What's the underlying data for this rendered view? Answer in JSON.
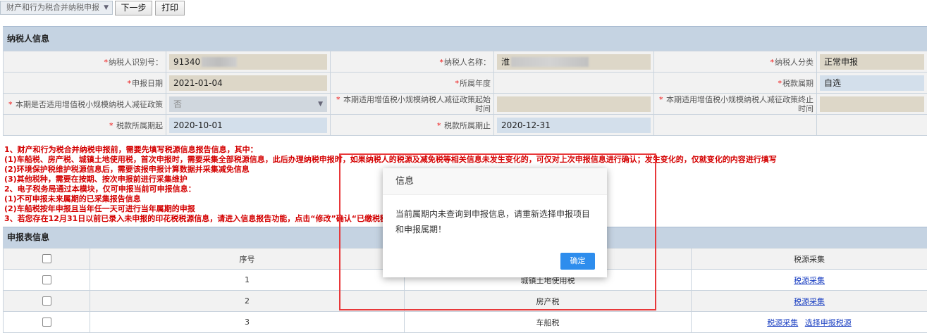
{
  "toolbar": {
    "project_select": "财产和行为税合并纳税申报",
    "next_label": "下一步",
    "print_label": "打印"
  },
  "taxpayer_section": {
    "title": "纳税人信息",
    "id_label": "纳税人识别号：",
    "id_value": "91340",
    "name_label": "纳税人名称：",
    "name_value": "淮",
    "category_label": "纳税人分类",
    "category_value": "正常申报",
    "date_label": "申报日期",
    "date_value": "2021-01-04",
    "year_label": "所属年度",
    "period_label": "税款属期",
    "period_value": "自选",
    "policy_label": "本期是否适用增值税小规模纳税人减征政策",
    "policy_value": "否",
    "policy_start_label": "本期适用增值税小规模纳税人减征政策起始时间",
    "policy_end_label": "本期适用增值税小规模纳税人减征政策终止时间",
    "start_label": "税款所属期起",
    "start_value": "2020-10-01",
    "end_label": "税款所属期止",
    "end_value": "2020-12-31"
  },
  "notices": [
    "1、财产和行为税合并纳税申报前，需要先填写税源信息报告信息，其中：",
    "(1)车船税、房产税、城镇土地使用税，首次申报时，需要采集全部税源信息，此后办理纳税申报时，如果纳税人的税源及减免税等相关信息未发生变化的，可仅对上次申报信息进行确认；发生变化的，仅就变化的内容进行填写",
    "(2)环境保护税维护税源信息后，需要该报申报计算数据并采集减免信息",
    "(3)其他税种，需要在按期、按次申报前进行采集维护",
    "2、电子税务局通过本模块，仅可申报当前可申报信息：",
    "(1)不可申报未来属期的已采集报告信息",
    "(2)车船税按年申报且当年任一天可进行当年属期的申报",
    "3、若您存在12月31日以前已录入未申报的印花税税源信息，请进入信息报告功能，点击“修改”确认“已缴税额”"
  ],
  "declaration_section": {
    "title": "申报表信息",
    "col_seq": "序号",
    "col_source": "税源采集",
    "rows": [
      {
        "seq": "1",
        "tax": "城镇土地使用税",
        "links": [
          "税源采集"
        ]
      },
      {
        "seq": "2",
        "tax": "房产税",
        "links": [
          "税源采集"
        ]
      },
      {
        "seq": "3",
        "tax": "车船税",
        "links": [
          "税源采集",
          "选择申报税源"
        ]
      }
    ]
  },
  "dialog": {
    "title": "信息",
    "message": "当前属期内未查询到申报信息，请重新选择申报项目和申报属期！",
    "confirm_label": "确定"
  },
  "colors": {
    "header_bar": "#c5d3e2",
    "notice_red": "#d40000",
    "highlight_frame": "#e8383a",
    "confirm_button": "#2e8ded",
    "link": "#1a3fc2"
  }
}
